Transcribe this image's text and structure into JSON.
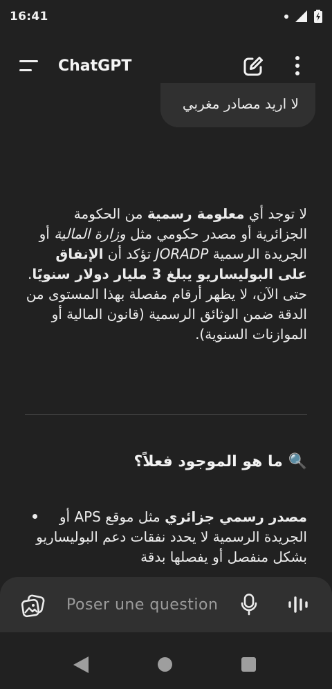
{
  "status_bar": {
    "time": "16:41"
  },
  "app_bar": {
    "title": "ChatGPT"
  },
  "user_message": "لا اريد مصادر مغربي",
  "answer": {
    "p1": "لا توجد أي ",
    "b1": "معلومة رسمية",
    "p2": " من الحكومة الجزائرية أو مصدر حكومي مثل ",
    "i1": "وزارة المالية",
    "p3": " أو الجريدة الرسمية ",
    "i2": "JORADP",
    "p4": " تؤكد أن ",
    "b2": "الإنفاق على البوليساريو يبلغ 3 مليار دولار سنويًا",
    "p5": ". حتى الآن، لا يظهر أرقام مفصلة بهذا المستوى من الدقة ضمن الوثائق الرسمية (قانون المالية أو الموازنات السنوية)."
  },
  "section": {
    "emoji": "🔍",
    "heading": "ما هو الموجود فعلاً؟"
  },
  "bullet": {
    "bold": "مصدر رسمي جزائري",
    "text": " مثل موقع APS أو الجريدة الرسمية لا يحدد نفقات دعم البوليساريو بشكل منفصل أو يفصلها بدقة"
  },
  "composer": {
    "placeholder": "Poser une question"
  },
  "icons": {
    "menu": "menu-icon",
    "edit": "new-chat-icon",
    "more": "more-vert-icon",
    "image": "image-gallery-icon",
    "mic": "microphone-icon",
    "voice": "voice-mode-icon",
    "search_emoji": "magnifying-glass"
  },
  "colors": {
    "background": "#212121",
    "surface": "#303030",
    "text": "#ececec",
    "placeholder": "#9b9b9b"
  }
}
